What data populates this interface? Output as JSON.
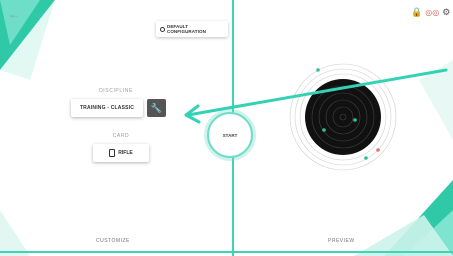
{
  "header": {
    "back_icon": "back-arrow-icon",
    "default_config_label": "DEFAULT CONFIGURATION",
    "icons": [
      "lock-icon",
      "targets-icon",
      "gear-icon"
    ]
  },
  "left": {
    "discipline_label": "DISCIPLINE",
    "discipline_value": "TRAINING - CLASSIC",
    "card_label": "CARD",
    "card_value": "RIFLE",
    "bottom_label": "CUSTOMIZE"
  },
  "center": {
    "start_label": "START"
  },
  "right": {
    "bottom_label": "PREVIEW"
  },
  "colors": {
    "accent": "#3fd3b8",
    "target": "#111111",
    "dot_green": "#2fbf9a",
    "dot_red": "#e07070"
  }
}
